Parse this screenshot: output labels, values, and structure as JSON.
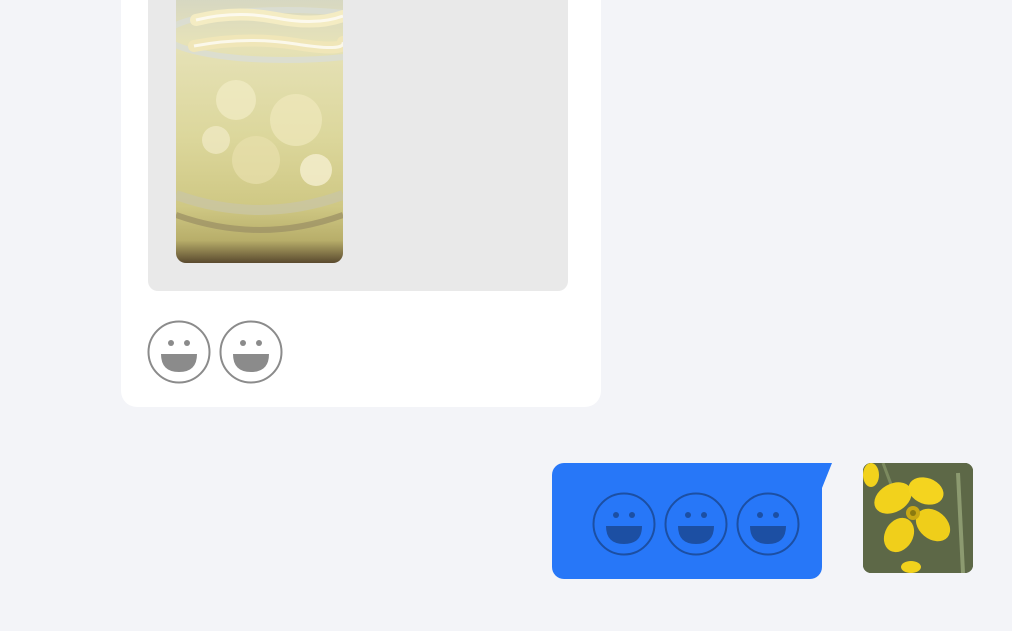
{
  "incoming": {
    "photo_icon": "food-photo",
    "emojis": [
      "grin-emoji",
      "grin-emoji"
    ]
  },
  "outgoing": {
    "emojis": [
      "grin-emoji",
      "grin-emoji",
      "grin-emoji"
    ],
    "bubble_color": "#2777f8"
  },
  "avatar": {
    "icon": "yellow-flower-avatar"
  },
  "colors": {
    "background": "#f3f4f8",
    "card": "#ffffff",
    "photo_frame": "#e9e9e9"
  }
}
